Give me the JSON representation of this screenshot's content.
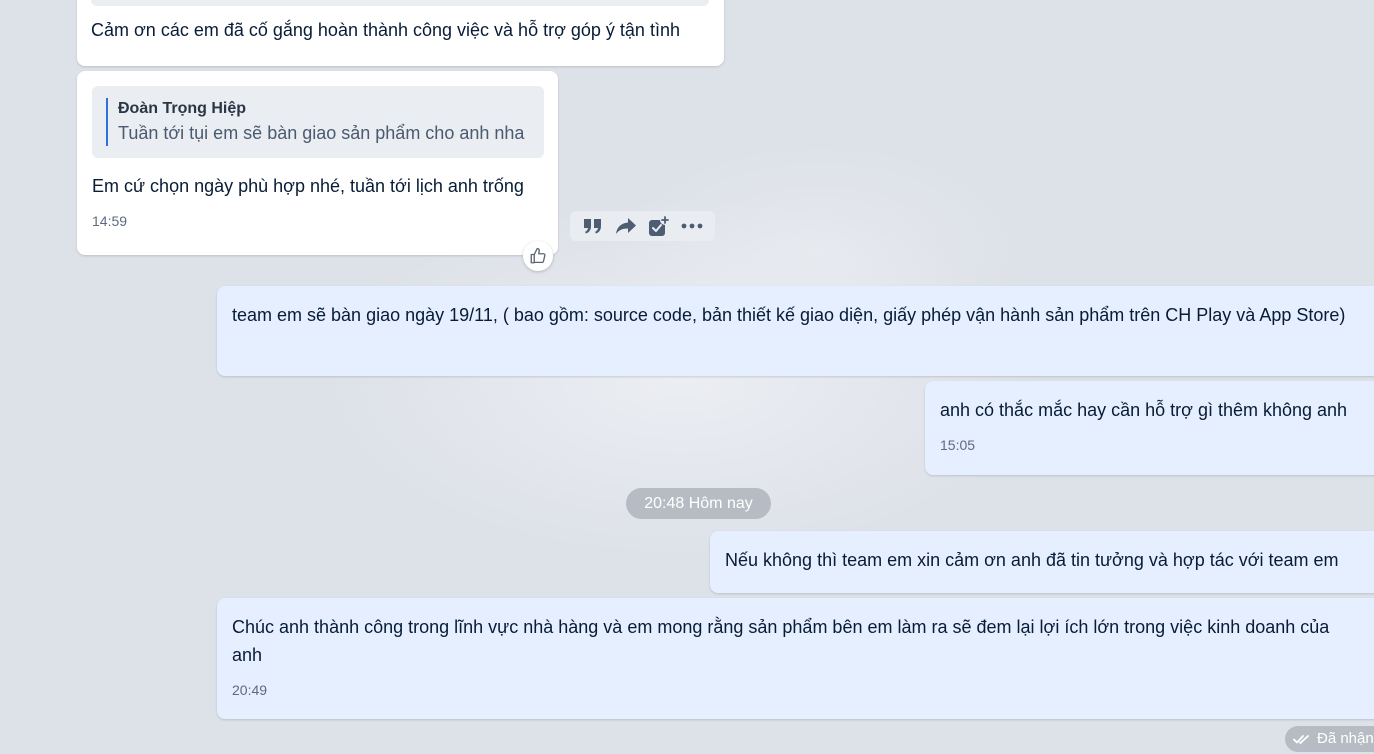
{
  "messages": {
    "m1": {
      "text": "Cảm ơn các em đã cố gắng hoàn thành công việc và hỗ trợ góp ý tận tình"
    },
    "m2": {
      "quote_author": "Đoàn Trọng Hiệp",
      "quote_text": "Tuần tới tụi em sẽ bàn giao sản phẩm cho anh nha",
      "text": "Em cứ chọn ngày phù hợp nhé, tuần tới lịch anh trống",
      "time": "14:59"
    },
    "m3": {
      "text": "team em sẽ bàn giao ngày 19/11, ( bao gồm: source code, bản thiết kế giao diện, giấy phép vận hành sản phẩm trên CH Play và App Store)"
    },
    "m4": {
      "text": "anh có thắc mắc hay cần hỗ trợ gì thêm không anh",
      "time": "15:05"
    },
    "m5": {
      "text": "Nếu không  thì team em xin cảm ơn anh đã tin tưởng và hợp tác với team em"
    },
    "m6": {
      "text": "Chúc anh thành công trong lĩnh vực nhà hàng và em mong rằng sản  phẩm bên em làm ra sẽ đem lại lợi ích lớn trong việc kinh doanh của anh",
      "time": "20:49"
    }
  },
  "date_divider": "20:48 Hôm nay",
  "status": "Đã nhận",
  "toolbar_icons": [
    "quote-icon",
    "forward-icon",
    "add-task-icon",
    "more-icon"
  ],
  "colors": {
    "incoming_bg": "#ffffff",
    "outgoing_bg": "#e5efff",
    "chat_bg": "#dde1e8",
    "quote_accent": "#2e6fd9"
  }
}
